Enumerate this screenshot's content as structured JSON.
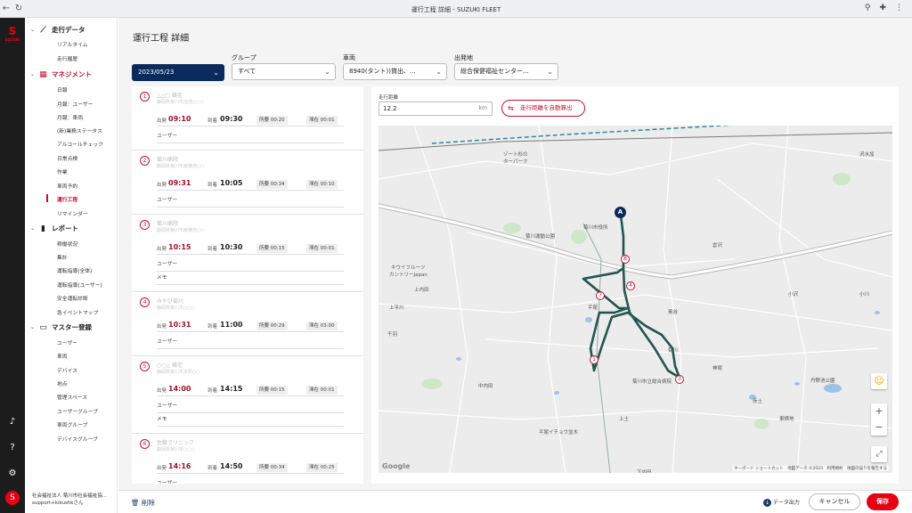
{
  "browser": {
    "title": "運行工程 詳細 - SUZUKI FLEET"
  },
  "brand": {
    "name": "SUZUKI",
    "accent": "#e60012",
    "navy": "#0a2a5c"
  },
  "sidebar": {
    "sections": [
      {
        "title": "走行データ",
        "icon": "route-icon",
        "items": [
          "リアルタイム",
          "走行履歴"
        ]
      },
      {
        "title": "マネジメント",
        "icon": "calendar-icon",
        "items": [
          "日報",
          "月報：ユーザー",
          "月報：車両",
          "(新)業務ステータス",
          "アルコールチェック",
          "日常点検",
          "作業",
          "車両予約",
          "運行工程",
          "リマインダー"
        ]
      },
      {
        "title": "レポート",
        "icon": "bar-chart-icon",
        "items": [
          "稼働状況",
          "集計",
          "運転指導(全体)",
          "運転指導(ユーザー)",
          "安全運転診断",
          "急イベントマップ"
        ]
      },
      {
        "title": "マスター登録",
        "icon": "briefcase-icon",
        "items": [
          "ユーザー",
          "車両",
          "デバイス",
          "地点",
          "管理スペース",
          "ユーザーグループ",
          "車両グループ",
          "デバイスグループ"
        ]
      }
    ],
    "active_item": "運行工程",
    "org_line1": "社会福祉法人 菊川市社会福祉協...",
    "org_line2": "support+kikushkさん",
    "user_initial": "S"
  },
  "page": {
    "title": "運行工程 詳細"
  },
  "filters": {
    "date": "2023/05/23",
    "group_label": "グループ",
    "group_value": "すべて",
    "vehicle_label": "車両",
    "vehicle_value": "8940(タント))貸出、...",
    "origin_label": "出発地",
    "origin_value": "総合保健福祉センター..."
  },
  "labels": {
    "depart": "出発",
    "arrive": "到着",
    "duration": "所要",
    "stay": "滞在"
  },
  "stops": [
    {
      "num": "1",
      "name": "△△□ 様宅",
      "address": "静岡県菊川市加茂○○○",
      "depart": "09:10",
      "arrive": "09:30",
      "duration": "00:20",
      "stay": "00:01",
      "extras": [
        "ユーザー"
      ]
    },
    {
      "num": "2",
      "name": "菊川病院",
      "address": "静岡県菊川市東横地○○",
      "depart": "09:31",
      "arrive": "10:05",
      "duration": "00:34",
      "stay": "00:10",
      "extras": [
        "ユーザー"
      ]
    },
    {
      "num": "3",
      "name": "菊川病院",
      "address": "静岡県菊川市東横地○○",
      "depart": "10:15",
      "arrive": "10:30",
      "duration": "00:15",
      "stay": "00:01",
      "extras": [
        "ユーザー",
        "メモ"
      ]
    },
    {
      "num": "4",
      "name": "みやび菊川",
      "address": "静岡県菊川市○○○",
      "depart": "10:31",
      "arrive": "11:00",
      "duration": "00:29",
      "stay": "03:00",
      "extras": [
        "ユーザー"
      ]
    },
    {
      "num": "5",
      "name": "○○△ 様宅",
      "address": "静岡県菊川市本所○○",
      "depart": "14:00",
      "arrive": "14:15",
      "duration": "00:15",
      "stay": "00:01",
      "extras": [
        "ユーザー",
        "メモ"
      ]
    },
    {
      "num": "6",
      "name": "佐藤クリニック",
      "address": "静岡県菊川市○○○",
      "depart": "14:16",
      "arrive": "14:50",
      "duration": "00:34",
      "stay": "00:25",
      "extras": [
        "ユーザー"
      ]
    }
  ],
  "distance": {
    "label": "走行距離",
    "value": "12.2",
    "unit": "km",
    "auto_button": "走行距離を自動算出"
  },
  "map": {
    "labels": [
      "ゾート杉の",
      "ターパーク",
      "菊川運動公園",
      "菊川市役所",
      "キウイフルーツ",
      "カントリーJapan",
      "上内田",
      "上平川",
      "中内田",
      "平尾",
      "菊川市立総合病院",
      "丹野池公園",
      "東横地",
      "神尾",
      "赤土",
      "沢水加",
      "小沢",
      "上土",
      "下内田",
      "平尾イチョウ並木",
      "千羽",
      "小川",
      "奥谷",
      "菊川",
      "倉沢"
    ],
    "attribution": "キーボード ショートカット　地図データ ©2023　利用規約　地図の誤りを報告する",
    "logo": "Google"
  },
  "footer": {
    "delete": "削除",
    "export": "データ出力",
    "cancel": "キャンセル",
    "save": "保存"
  }
}
